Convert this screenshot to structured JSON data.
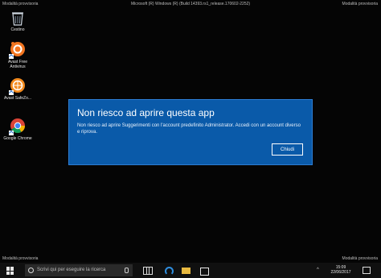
{
  "watermarks": {
    "top_left": "Modalità provvisoria",
    "top_center": "Microsoft (R) Windows (R) (Build 14393.rs1_release.170602-2252)",
    "top_right": "Modalità provvisoria",
    "bottom_left": "Modalità provvisoria",
    "bottom_right": "Modalità provvisoria"
  },
  "desktop": {
    "icons": [
      {
        "label": "Cestino",
        "icon": "recycle-bin-icon"
      },
      {
        "label": "Avast Free Antivirus",
        "icon": "avast-icon"
      },
      {
        "label": "Avast SafeZo...",
        "icon": "avast-safezone-icon"
      },
      {
        "label": "Google Chrome",
        "icon": "chrome-icon"
      }
    ]
  },
  "dialog": {
    "title": "Non riesco ad aprire questa app",
    "message": "Non riesco ad aprire Suggerimenti con l'account predefinito Administrator. Accedi con un account diverso e riprova.",
    "close_label": "Chiudi"
  },
  "taskbar": {
    "search_placeholder": "Scrivi qui per eseguire la ricerca",
    "time": "15:09",
    "date": "22/06/2017"
  },
  "colors": {
    "dialog_background": "#0a5aa9",
    "desktop_background": "#050505"
  }
}
